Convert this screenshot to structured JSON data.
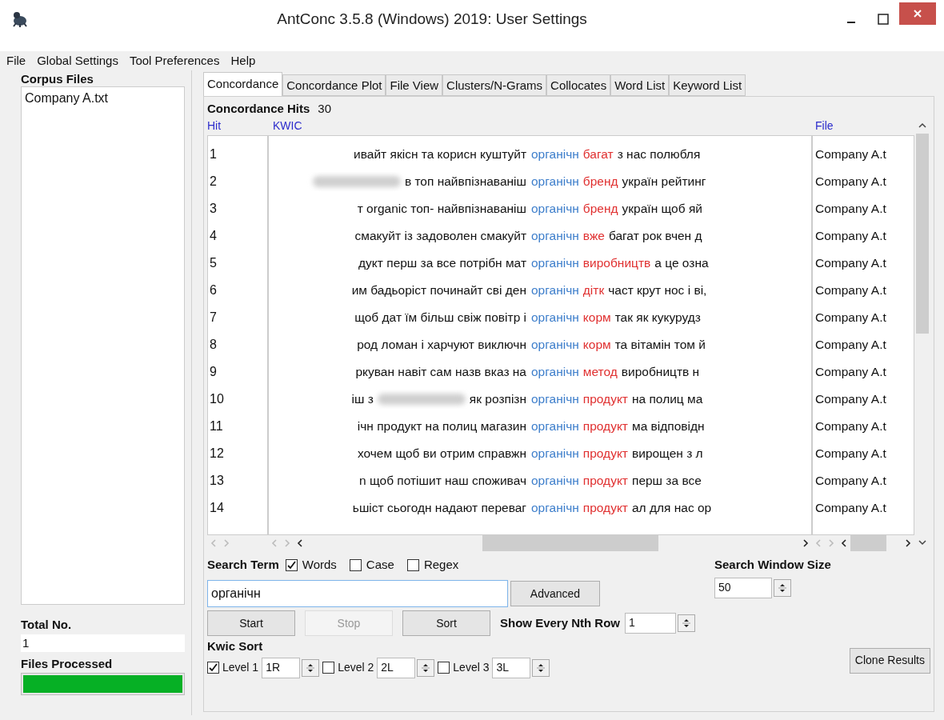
{
  "window": {
    "title": "AntConc 3.5.8 (Windows) 2019: User Settings"
  },
  "menu": [
    "File",
    "Global Settings",
    "Tool Preferences",
    "Help"
  ],
  "corpus_files": {
    "heading": "Corpus Files",
    "files": [
      "Company A.txt"
    ]
  },
  "total_no": {
    "label": "Total No.",
    "value": "1"
  },
  "files_processed": {
    "label": "Files Processed",
    "level": 1
  },
  "tabs": [
    {
      "label": "Concordance",
      "selected": true
    },
    {
      "label": "Concordance Plot",
      "selected": false
    },
    {
      "label": "File View",
      "selected": false
    },
    {
      "label": "Clusters/N-Grams",
      "selected": false
    },
    {
      "label": "Collocates",
      "selected": false
    },
    {
      "label": "Word List",
      "selected": false
    },
    {
      "label": "Keyword List",
      "selected": false
    }
  ],
  "hits": {
    "label": "Concordance Hits",
    "value": "30"
  },
  "columns": [
    "Hit",
    "KWIC",
    "File"
  ],
  "rows": [
    {
      "hit": "1",
      "left": [
        {
          "kind": "text",
          "text": "ивайт якісн та корисн куштуйт"
        }
      ],
      "keyword": "органічн",
      "sort_word": "багат",
      "right": "з нас полюбля",
      "file": "Company A.t"
    },
    {
      "hit": "2",
      "left": [
        {
          "kind": "redacted"
        },
        {
          "kind": "text",
          "text": "в топ найвпізнаваніш"
        }
      ],
      "keyword": "органічн",
      "sort_word": "бренд",
      "right": "україн рейтинг",
      "file": "Company A.t"
    },
    {
      "hit": "3",
      "left": [
        {
          "kind": "text",
          "text": "т organic топ- найвпізнаваніш"
        }
      ],
      "keyword": "органічн",
      "sort_word": "бренд",
      "right": "україн щоб яй",
      "file": "Company A.t"
    },
    {
      "hit": "4",
      "left": [
        {
          "kind": "text",
          "text": "смакуйт із задоволен смакуйт"
        }
      ],
      "keyword": "органічн",
      "sort_word": "вже",
      "right": "багат рок вчен д",
      "file": "Company A.t"
    },
    {
      "hit": "5",
      "left": [
        {
          "kind": "text",
          "text": "дукт перш за все потрібн мат"
        }
      ],
      "keyword": "органічн",
      "sort_word": "виробництв",
      "right": "а це озна",
      "file": "Company A.t"
    },
    {
      "hit": "6",
      "left": [
        {
          "kind": "text",
          "text": "им бадьоріст починайт сві ден"
        }
      ],
      "keyword": "органічн",
      "sort_word": "дітк",
      "right": "част крут нос і ві,",
      "file": "Company A.t"
    },
    {
      "hit": "7",
      "left": [
        {
          "kind": "text",
          "text": "щоб дат їм більш свіж повітр і"
        }
      ],
      "keyword": "органічн",
      "sort_word": "корм",
      "right": "так як кукурудз",
      "file": "Company A.t"
    },
    {
      "hit": "8",
      "left": [
        {
          "kind": "text",
          "text": "род ломан і харчуют виключн"
        }
      ],
      "keyword": "органічн",
      "sort_word": "корм",
      "right": "та вітамін том й",
      "file": "Company A.t"
    },
    {
      "hit": "9",
      "left": [
        {
          "kind": "text",
          "text": "ркуван навіт сам назв вказ на"
        }
      ],
      "keyword": "органічн",
      "sort_word": "метод",
      "right": "виробництв н",
      "file": "Company A.t"
    },
    {
      "hit": "10",
      "left": [
        {
          "kind": "text",
          "text": "іш з"
        },
        {
          "kind": "redacted"
        },
        {
          "kind": "text",
          "text": "як розпізн"
        }
      ],
      "keyword": "органічн",
      "sort_word": "продукт",
      "right": "на полиц ма",
      "file": "Company A.t"
    },
    {
      "hit": "11",
      "left": [
        {
          "kind": "text",
          "text": "ічн продукт на полиц магазин"
        }
      ],
      "keyword": "органічн",
      "sort_word": "продукт",
      "right": "ма відповідн",
      "file": "Company A.t"
    },
    {
      "hit": "12",
      "left": [
        {
          "kind": "text",
          "text": "хочем щоб ви отрим справжн"
        }
      ],
      "keyword": "органічн",
      "sort_word": "продукт",
      "right": "вирощен з л",
      "file": "Company A.t"
    },
    {
      "hit": "13",
      "left": [
        {
          "kind": "text",
          "text": "n щоб потішит наш споживач"
        }
      ],
      "keyword": "органічн",
      "sort_word": "продукт",
      "right": "перш за все",
      "file": "Company A.t"
    },
    {
      "hit": "14",
      "left": [
        {
          "kind": "text",
          "text": "ьшіст сьогодн надают переваг"
        }
      ],
      "keyword": "органічн",
      "sort_word": "продукт",
      "right": "ал для нас ор",
      "file": "Company A.t"
    }
  ],
  "search": {
    "label": "Search Term",
    "options": [
      {
        "label": "Words",
        "checked": true
      },
      {
        "label": "Case",
        "checked": false
      },
      {
        "label": "Regex",
        "checked": false
      }
    ],
    "value": "органічн",
    "advanced": "Advanced"
  },
  "window_size": {
    "label": "Search Window Size",
    "value": "50"
  },
  "buttons": [
    {
      "label": "Start",
      "disabled": false
    },
    {
      "label": "Stop",
      "disabled": true
    },
    {
      "label": "Sort",
      "disabled": false
    }
  ],
  "nth_row": {
    "label": "Show Every Nth Row",
    "value": "1"
  },
  "kwic_sort": {
    "label": "Kwic Sort",
    "levels": [
      {
        "label": "Level 1",
        "checked": true,
        "value": "1R"
      },
      {
        "label": "Level 2",
        "checked": false,
        "value": "2L"
      },
      {
        "label": "Level 3",
        "checked": false,
        "value": "3L"
      }
    ]
  },
  "clone": "Clone Results"
}
